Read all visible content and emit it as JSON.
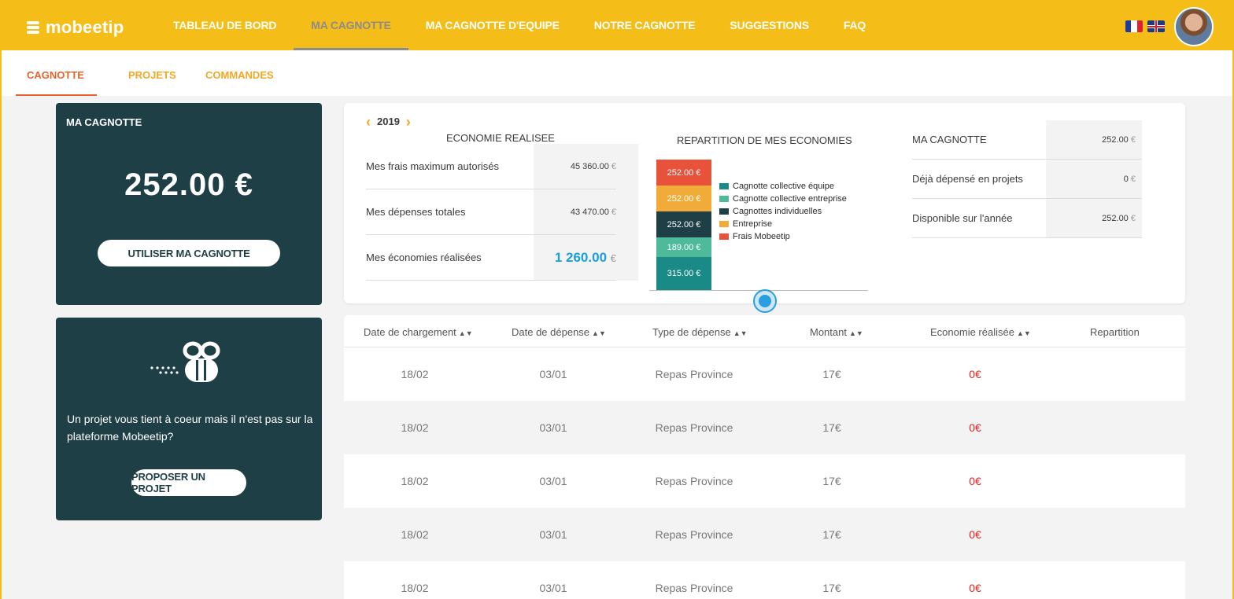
{
  "brand": {
    "name": "mobeetip"
  },
  "nav": {
    "items": [
      {
        "label": "TABLEAU DE BORD",
        "active": false
      },
      {
        "label": "MA CAGNOTTE",
        "active": true
      },
      {
        "label": "MA CAGNOTTE D'EQUIPE",
        "active": false
      },
      {
        "label": "NOTRE CAGNOTTE",
        "active": false
      },
      {
        "label": "SUGGESTIONS",
        "active": false
      },
      {
        "label": "FAQ",
        "active": false
      }
    ],
    "languages": [
      "fr-flag-icon",
      "uk-flag-icon"
    ]
  },
  "subnav": {
    "tabs": [
      {
        "label": "CAGNOTTE",
        "active": true
      },
      {
        "label": "PROJETS",
        "active": false
      },
      {
        "label": "COMMANDES",
        "active": false
      }
    ]
  },
  "cagnotte_card": {
    "title": "MA CAGNOTTE",
    "amount": "252.00 €",
    "button": "UTILISER MA CAGNOTTE"
  },
  "projet_card": {
    "text": "Un projet vous tient à coeur mais il n'est pas sur la plateforme Mobeetip?",
    "button": "PROPOSER UN PROJET"
  },
  "summary": {
    "year": "2019",
    "economie": {
      "title": "ECONOMIE REALISEE",
      "rows": [
        {
          "label": "Mes frais maximum autorisés",
          "value": "45 360.00",
          "currency": "€"
        },
        {
          "label": "Mes dépenses totales",
          "value": "43 470.00",
          "currency": "€"
        },
        {
          "label": "Mes économies réalisées",
          "value": "1 260.00",
          "currency": "€"
        }
      ]
    },
    "repartition": {
      "title": "REPARTITION DE MES ECONOMIES",
      "segments": [
        {
          "label": "252.00 €",
          "value": 252.0,
          "color": "#e8513a"
        },
        {
          "label": "252.00 €",
          "value": 252.0,
          "color": "#f0ab38"
        },
        {
          "label": "252.00 €",
          "value": 252.0,
          "color": "#1f3f47"
        },
        {
          "label": "189.00 €",
          "value": 189.0,
          "color": "#4fba9a"
        },
        {
          "label": "315.00 €",
          "value": 315.0,
          "color": "#1a8a87"
        }
      ],
      "legend": [
        {
          "label": "Cagnotte collective équipe",
          "color": "#1a8a87"
        },
        {
          "label": "Cagnotte collective entreprise",
          "color": "#4fba9a"
        },
        {
          "label": "Cagnottes individuelles",
          "color": "#1f3f47"
        },
        {
          "label": "Entreprise",
          "color": "#f0ab38"
        },
        {
          "label": "Frais Mobeetip",
          "color": "#e8513a"
        }
      ]
    },
    "cagnotte": {
      "rows": [
        {
          "label": "MA CAGNOTTE",
          "value": "252.00",
          "currency": "€"
        },
        {
          "label": "Déjà dépensé en projets",
          "value": "0",
          "currency": "€"
        },
        {
          "label": "Disponible sur l'année",
          "value": "252.00",
          "currency": "€"
        }
      ]
    }
  },
  "table": {
    "headers": [
      {
        "label": "Date de chargement",
        "sortable": true
      },
      {
        "label": "Date de dépense",
        "sortable": true
      },
      {
        "label": "Type de dépense",
        "sortable": true
      },
      {
        "label": "Montant",
        "sortable": true
      },
      {
        "label": "Economie réalisée",
        "sortable": true
      },
      {
        "label": "Repartition",
        "sortable": false
      }
    ],
    "rows": [
      {
        "date_chargement": "18/02",
        "date_depense": "03/01",
        "type": "Repas Province",
        "montant": "17€",
        "economie": "0€"
      },
      {
        "date_chargement": "18/02",
        "date_depense": "03/01",
        "type": "Repas Province",
        "montant": "17€",
        "economie": "0€"
      },
      {
        "date_chargement": "18/02",
        "date_depense": "03/01",
        "type": "Repas Province",
        "montant": "17€",
        "economie": "0€"
      },
      {
        "date_chargement": "18/02",
        "date_depense": "03/01",
        "type": "Repas Province",
        "montant": "17€",
        "economie": "0€"
      },
      {
        "date_chargement": "18/02",
        "date_depense": "03/01",
        "type": "Repas Province",
        "montant": "17€",
        "economie": "0€"
      }
    ]
  },
  "colors": {
    "brand_yellow": "#f5bd17",
    "dark_teal": "#1f3f47",
    "accent_orange": "#e8632b",
    "economy_blue": "#1a9fd9",
    "economy_red": "#e02020"
  }
}
